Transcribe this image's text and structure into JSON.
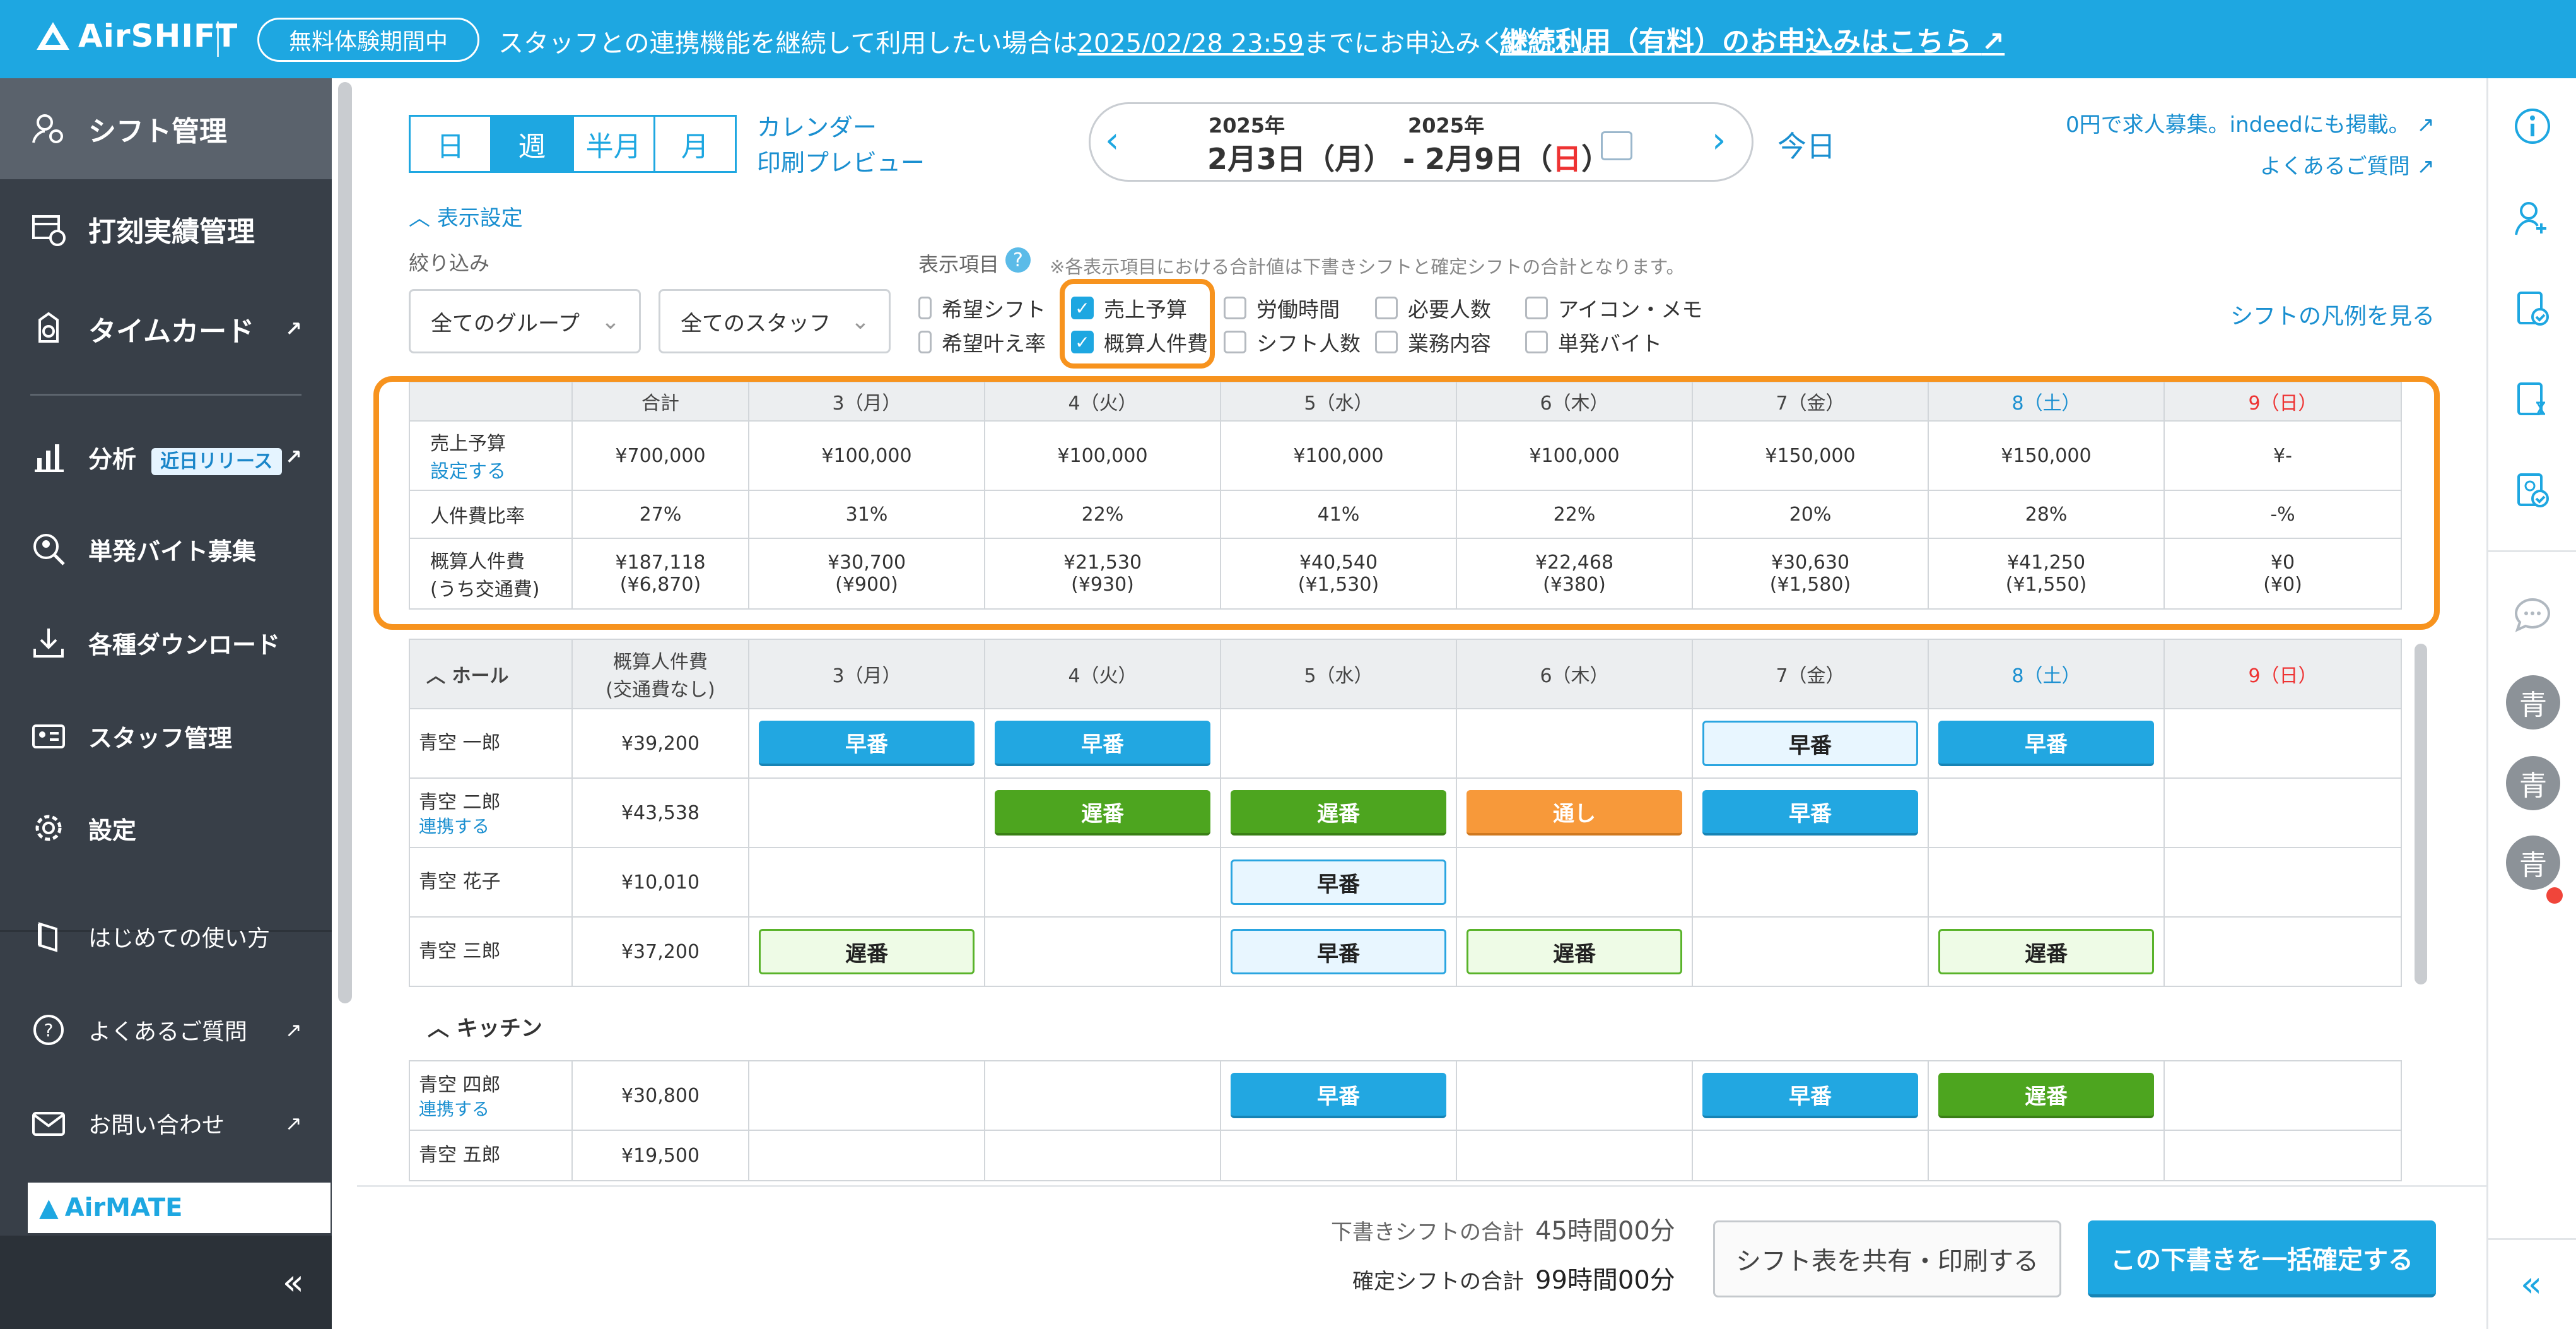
{
  "banner": {
    "logo": "AirSHIFT",
    "trial_badge": "無料体験期間中",
    "msg_before": "スタッフとの連携機能を継続して利用したい場合は",
    "msg_date": "2025/02/28 23:59",
    "msg_after": "までにお申込みください。",
    "link": "継続利用（有料）のお申込みはこちら"
  },
  "sidebar": {
    "items": [
      {
        "label": "シフト管理",
        "icon": "staff-gear-icon"
      },
      {
        "label": "打刻実績管理",
        "icon": "clock-table-icon"
      },
      {
        "label": "タイムカード",
        "icon": "timecard-icon"
      },
      {
        "label": "分析",
        "icon": "bar-chart-icon",
        "badge": "近日リリース"
      },
      {
        "label": "単発バイト募集",
        "icon": "person-search-icon"
      },
      {
        "label": "各種ダウンロード",
        "icon": "download-icon"
      },
      {
        "label": "スタッフ管理",
        "icon": "id-card-icon"
      },
      {
        "label": "設定",
        "icon": "gear-icon"
      },
      {
        "label": "はじめての使い方",
        "icon": "book-icon"
      },
      {
        "label": "よくあるご質問",
        "icon": "question-icon"
      },
      {
        "label": "お問い合わせ",
        "icon": "mail-icon"
      }
    ],
    "airmate": "AirMATE",
    "collapse": "«"
  },
  "toolbar": {
    "views": [
      "日",
      "週",
      "半月",
      "月"
    ],
    "active_view": "週",
    "cal_preview_1": "カレンダー",
    "cal_preview_2": "印刷プレビュー",
    "year_start": "2025年",
    "year_end": "2025年",
    "date_start": "2月3日（月）",
    "date_sep": "-",
    "date_end_pre": "2月9日（",
    "date_end_day": "日",
    "date_end_post": "）",
    "today": "今日",
    "recruit": "0円で求人募集。indeedにも掲載。",
    "faq": "よくあるご質問"
  },
  "settings": {
    "toggle": "表示設定",
    "filter_label": "絞り込み",
    "group_select": "全てのグループ",
    "staff_select": "全てのスタッフ",
    "items_label": "表示項目",
    "note": "※各表示項目における合計値は下書きシフトと確定シフトの合計となります。",
    "checkboxes": [
      {
        "label": "希望シフト",
        "checked": false
      },
      {
        "label": "希望叶え率",
        "checked": false
      },
      {
        "label": "売上予算",
        "checked": true
      },
      {
        "label": "概算人件費",
        "checked": true
      },
      {
        "label": "労働時間",
        "checked": false
      },
      {
        "label": "シフト人数",
        "checked": false
      },
      {
        "label": "必要人数",
        "checked": false
      },
      {
        "label": "業務内容",
        "checked": false
      },
      {
        "label": "アイコン・メモ",
        "checked": false
      },
      {
        "label": "単発バイト",
        "checked": false
      }
    ],
    "legend_link": "シフトの凡例を見る"
  },
  "summary": {
    "headers": [
      "合計",
      "3（月）",
      "4（火）",
      "5（水）",
      "6（木）",
      "7（金）",
      "8（土）",
      "9（日）"
    ],
    "sales_label": "売上予算",
    "sales_link": "設定する",
    "sales": [
      "¥700,000",
      "¥100,000",
      "¥100,000",
      "¥100,000",
      "¥100,000",
      "¥150,000",
      "¥150,000",
      "¥-"
    ],
    "ratio_label": "人件費比率",
    "ratio": [
      "27%",
      "31%",
      "22%",
      "41%",
      "22%",
      "20%",
      "28%",
      "-%"
    ],
    "cost_label_1": "概算人件費",
    "cost_label_2": "(うち交通費)",
    "cost": [
      "¥187,118",
      "¥30,700",
      "¥21,530",
      "¥40,540",
      "¥22,468",
      "¥30,630",
      "¥41,250",
      "¥0"
    ],
    "transport": [
      "(¥6,870)",
      "(¥900)",
      "(¥930)",
      "(¥1,530)",
      "(¥380)",
      "(¥1,580)",
      "(¥1,550)",
      "(¥0)"
    ]
  },
  "hall": {
    "title": "ホール",
    "cost_header_1": "概算人件費",
    "cost_header_2": "(交通費なし)",
    "days": [
      "3（月）",
      "4（火）",
      "5（水）",
      "6（木）",
      "7（金）",
      "8（土）",
      "9（日）"
    ],
    "staff": [
      {
        "name": "青空 一郎",
        "link": "",
        "cost": "¥39,200",
        "shifts": [
          [
            "早番",
            "early"
          ],
          [
            "早番",
            "early"
          ],
          [
            "",
            ""
          ],
          [
            "",
            ""
          ],
          [
            "早番",
            "early-o"
          ],
          [
            "早番",
            "early"
          ],
          [
            "",
            ""
          ]
        ]
      },
      {
        "name": "青空 二郎",
        "link": "連携する",
        "cost": "¥43,538",
        "shifts": [
          [
            "",
            ""
          ],
          [
            "遅番",
            "late"
          ],
          [
            "遅番",
            "late"
          ],
          [
            "通し",
            "thru"
          ],
          [
            "早番",
            "early"
          ],
          [
            "",
            ""
          ],
          [
            "",
            ""
          ]
        ]
      },
      {
        "name": "青空 花子",
        "link": "",
        "cost": "¥10,010",
        "shifts": [
          [
            "",
            ""
          ],
          [
            "",
            ""
          ],
          [
            "早番",
            "early-o"
          ],
          [
            "",
            ""
          ],
          [
            "",
            ""
          ],
          [
            "",
            ""
          ],
          [
            "",
            ""
          ]
        ]
      },
      {
        "name": "青空 三郎",
        "link": "",
        "cost": "¥37,200",
        "shifts": [
          [
            "遅番",
            "late-o"
          ],
          [
            "",
            ""
          ],
          [
            "早番",
            "early-o"
          ],
          [
            "遅番",
            "late-o"
          ],
          [
            "",
            ""
          ],
          [
            "遅番",
            "late-o"
          ],
          [
            "",
            ""
          ]
        ]
      }
    ]
  },
  "kitchen": {
    "title": "キッチン",
    "staff": [
      {
        "name": "青空 四郎",
        "link": "連携する",
        "cost": "¥30,800",
        "shifts": [
          [
            "",
            ""
          ],
          [
            "",
            ""
          ],
          [
            "早番",
            "early"
          ],
          [
            "",
            ""
          ],
          [
            "早番",
            "early"
          ],
          [
            "遅番",
            "late"
          ],
          [
            "",
            ""
          ]
        ]
      },
      {
        "name": "青空 五郎",
        "link": "",
        "cost": "¥19,500",
        "shifts": [
          [
            "",
            ""
          ],
          [
            "",
            ""
          ],
          [
            "",
            ""
          ],
          [
            "",
            ""
          ],
          [
            "",
            ""
          ],
          [
            "",
            ""
          ],
          [
            "",
            ""
          ]
        ]
      }
    ]
  },
  "rail": {
    "avatars": [
      "青",
      "青",
      "青"
    ],
    "collapse": "«"
  },
  "footer": {
    "draft_label": "下書きシフトの合計",
    "draft_value": "45時間00分",
    "confirmed_label": "確定シフトの合計",
    "confirmed_value": "99時間00分",
    "share": "シフト表を共有・印刷する",
    "confirm": "この下書きを一括確定する"
  }
}
